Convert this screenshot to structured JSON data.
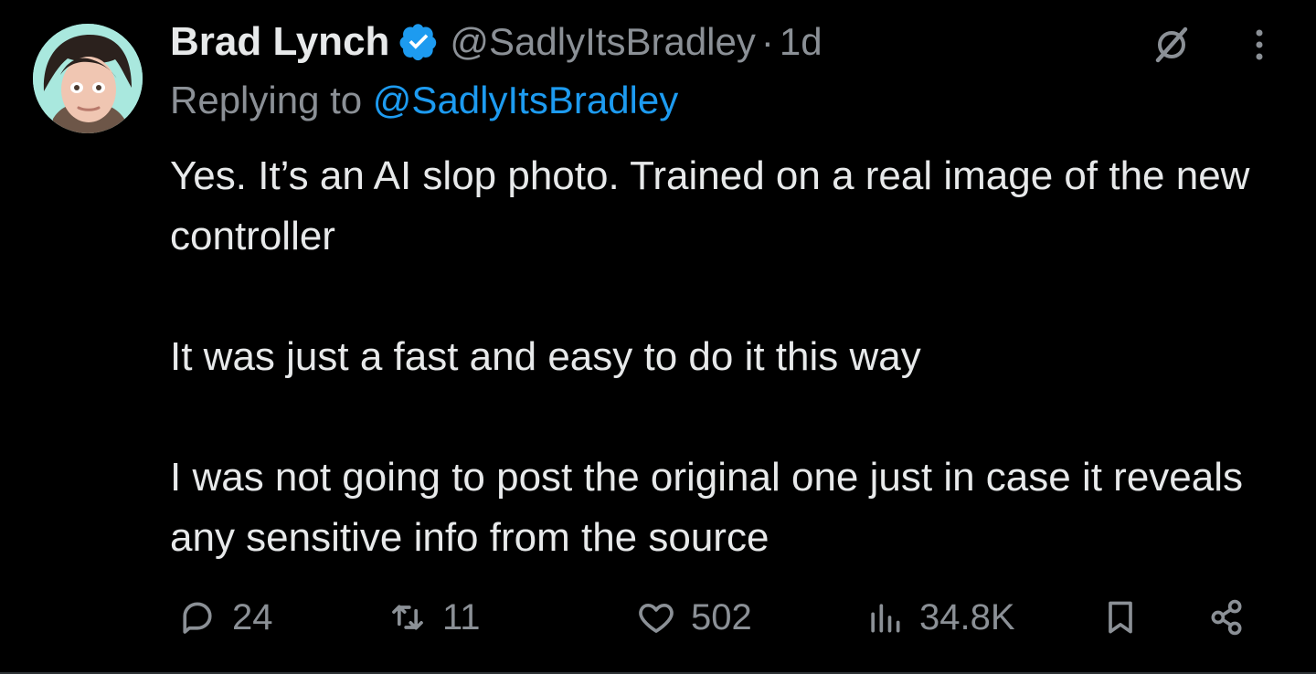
{
  "author": {
    "name": "Brad Lynch",
    "handle": "@SadlyItsBradley",
    "separator": "·",
    "time": "1d",
    "verified": true
  },
  "reply_to": {
    "prefix": "Replying to",
    "handle": "@SadlyItsBradley"
  },
  "tweet": {
    "paragraphs": [
      "Yes. It’s an AI slop photo. Trained on a real image of the new controller",
      "It was just a fast and easy to do it this way",
      "I was not going to post the original one just in case it reveals any sensitive info from the source"
    ]
  },
  "actions": {
    "replies": "24",
    "retweets": "11",
    "likes": "502",
    "views": "34.8K"
  },
  "icons": {
    "verified": "verified-badge-icon",
    "grok": "grok-icon",
    "more": "more-options-icon",
    "reply": "reply-icon",
    "retweet": "retweet-icon",
    "like": "heart-icon",
    "views": "views-icon",
    "bookmark": "bookmark-icon",
    "share": "share-icon"
  },
  "colors": {
    "background": "#000000",
    "text": "#e7e9ea",
    "secondary": "#8b9096",
    "link": "#1d9bf0",
    "verified": "#1d9bf0"
  }
}
